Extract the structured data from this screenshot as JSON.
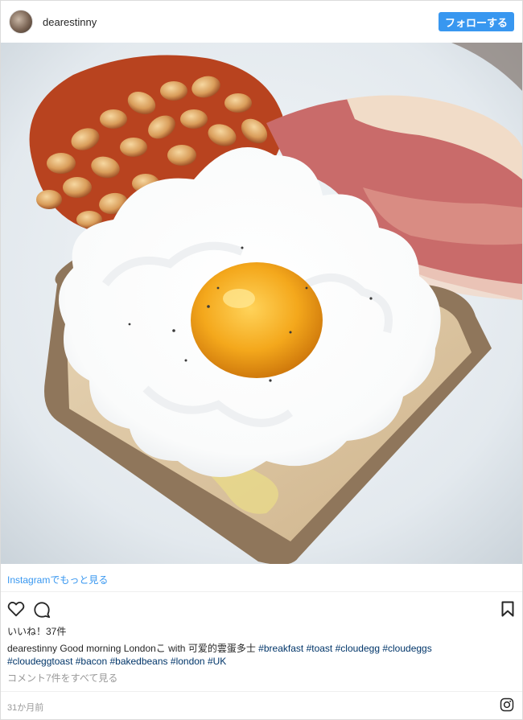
{
  "header": {
    "username": "dearestinny",
    "follow_label": "フォローする"
  },
  "photo": {
    "subject": "cloud egg toast with baked beans and bacon"
  },
  "view_more": "Instagramでもっと見る",
  "actions": {
    "icons": [
      "heart-icon",
      "comment-icon",
      "bookmark-icon"
    ]
  },
  "likes": "いいね！37件",
  "caption": {
    "username": "dearestinny",
    "text": "Good morning Londonこ with 可爱的雲蛋多士",
    "hashtags_line1": [
      "#breakfast",
      "#toast",
      "#cloudegg",
      "#cloudeggs"
    ],
    "hashtags_line2": [
      "#cloudeggtoast",
      "#bacon",
      "#bakedbeans",
      "#london",
      "#UK"
    ]
  },
  "comments_link": "コメント7件をすべて見る",
  "timestamp": "31か月前",
  "colors": {
    "accent": "#3897f0",
    "hashtag": "#003569",
    "muted": "#999999"
  }
}
